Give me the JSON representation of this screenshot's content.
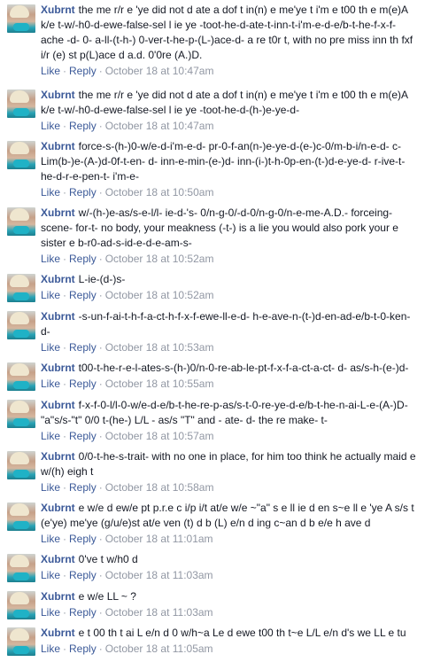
{
  "comments": [
    {
      "author": "Xubrnt",
      "text": "the me r/r e 'ye did not d ate a dof t in(n) e me'ye t i'm e t00 th e m(e)A k/e t-w/-h0-d-ewe-false-sel l ie ye -toot-he-d-ate-t-inn-t-i'm-e-d-e/b-t-he-f-x-f-ache -d- 0- a-ll-(t-h-) 0-ver-t-he-p-(L-)ace-d- a re t0r t, with no pre miss inn th fxf i/r (e) st p(L)ace d a.d. 0'0re (A.)D.",
      "like": "Like",
      "reply": "Reply",
      "time": "October 18 at 10:47am"
    },
    {
      "author": "Xubrnt",
      "text": "the me r/r e 'ye did not d ate a dof t in(n) e me'ye t i'm e t00 th e m(e)A k/e t-w/-h0-d-ewe-false-sel l ie ye -toot-he-d-(h-)e-ye-d-",
      "like": "Like",
      "reply": "Reply",
      "time": "October 18 at 10:47am"
    },
    {
      "author": "Xubrnt",
      "text": "force-s-(h-)0-w/e-d-i'm-e-d- pr-0-f-an(n-)e-ye-d-(e-)c-0/m-b-i/n-e-d- c-Lim(b-)e-(A-)d-0f-t-en- d- inn-e-min-(e-)d- inn-(i-)t-h-0p-en-(t-)d-e-ye-d- r-ive-t-he-d-r-e-pen-t- i'm-e-",
      "like": "Like",
      "reply": "Reply",
      "time": "October 18 at 10:50am"
    },
    {
      "author": "Xubrnt",
      "text": "w/-(h-)e-as/s-e-l/l- ie-d-'s- 0/n-g-0/-d-0/n-g-0/n-e-me-A.D.- forceing-scene- for-t- no body, your meakness (-t-) is a lie you would also pork your e sister e b-r0-ad-s-id-e-d-e-am-s-",
      "like": "Like",
      "reply": "Reply",
      "time": "October 18 at 10:52am"
    },
    {
      "author": "Xubrnt",
      "text": "L-ie-(d-)s-",
      "like": "Like",
      "reply": "Reply",
      "time": "October 18 at 10:52am"
    },
    {
      "author": "Xubrnt",
      "text": "-s-un-f-ai-t-h-f-a-ct-h-f-x-f-ewe-ll-e-d- h-e-ave-n-(t-)d-en-ad-e/b-t-0-ken-d-",
      "like": "Like",
      "reply": "Reply",
      "time": "October 18 at 10:53am"
    },
    {
      "author": "Xubrnt",
      "text": "t00-t-he-r-e-l-ates-s-(h-)0/n-0-re-ab-le-pt-f-x-f-a-ct-a-ct- d- as/s-h-(e-)d-",
      "like": "Like",
      "reply": "Reply",
      "time": "October 18 at 10:55am"
    },
    {
      "author": "Xubrnt",
      "text": "f-x-f-0-l/l-0-w/e-d-e/b-t-he-re-p-as/s-t-0-re-ye-d-e/b-t-he-n-ai-L-e-(A-)D- \"a\"s/s-\"t\" 0/0 t-(he-) L/L - as/s \"T\" and - ate- d- the re make- t-",
      "like": "Like",
      "reply": "Reply",
      "time": "October 18 at 10:57am"
    },
    {
      "author": "Xubrnt",
      "text": "0/0-t-he-s-trait- with no one in place, for him too think he actually maid e w/(h) eigh t",
      "like": "Like",
      "reply": "Reply",
      "time": "October 18 at 10:58am"
    },
    {
      "author": "Xubrnt",
      "text": "e w/e d ew/e pt p.r.e c i/p i/t at/e w/e ~\"a\" s e ll ie d en s~e ll e 'ye A s/s t (e'ye) me'ye (g/u/e)st at/e ven (t) d b (L) e/n d ing c~an d b e/e h ave d",
      "like": "Like",
      "reply": "Reply",
      "time": "October 18 at 11:01am"
    },
    {
      "author": "Xubrnt",
      "text": "0've t w/h0 d",
      "like": "Like",
      "reply": "Reply",
      "time": "October 18 at 11:03am"
    },
    {
      "author": "Xubrnt",
      "text": "e w/e LL ~ ?",
      "like": "Like",
      "reply": "Reply",
      "time": "October 18 at 11:03am"
    },
    {
      "author": "Xubrnt",
      "text": "e t 00 th t ai L e/n d 0 w/h~a Le d ewe t00 th t~e L/L e/n d's we LL e tu",
      "like": "Like",
      "reply": "Reply",
      "time": "October 18 at 11:05am"
    }
  ],
  "separator": "·"
}
